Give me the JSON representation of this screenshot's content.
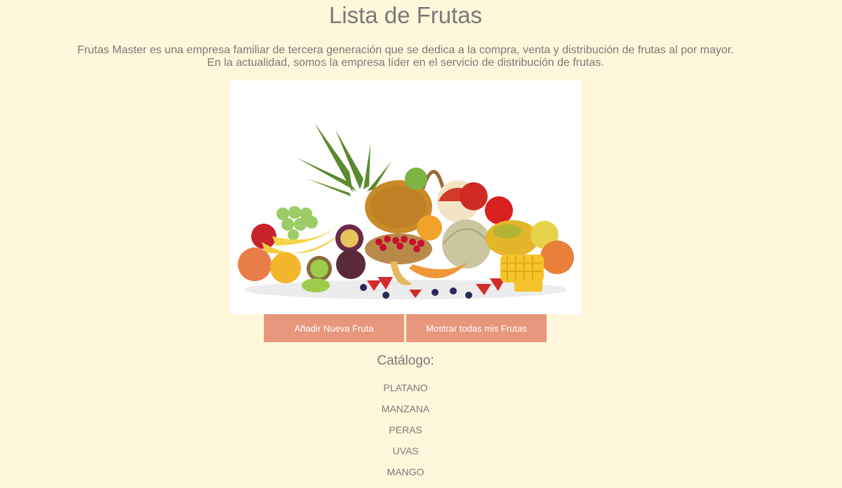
{
  "page": {
    "title": "Lista de Frutas",
    "intro_line1": "Frutas Master es una empresa familiar de tercera generación que se dedica a la compra, venta y distribución de frutas al por mayor.",
    "intro_line2": "En la actualidad, somos la empresa líder en el servicio de distribución de frutas."
  },
  "hero_image": {
    "alt": "fruit-assortment-image"
  },
  "actions": {
    "add_label": "Añadir Nueva Fruta",
    "show_all_label": "Mostrar todas mis Frutas"
  },
  "catalog": {
    "title": "Catálogo:",
    "items": [
      "PLATANO",
      "MANZANA",
      "PERAS",
      "UVAS",
      "MANGO"
    ]
  },
  "colors": {
    "background": "#fff7dc",
    "text": "#7a7a76",
    "button": "#e8977d"
  }
}
